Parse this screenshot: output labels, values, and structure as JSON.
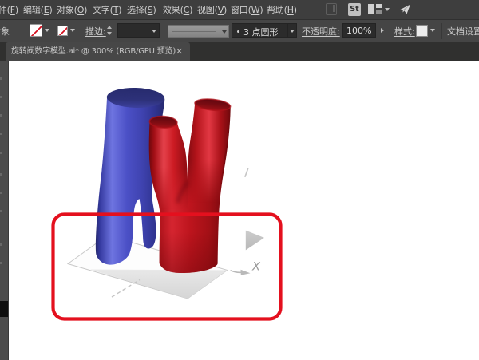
{
  "menubar": {
    "items": [
      {
        "pre": "文件(",
        "key": "F",
        "post": ")"
      },
      {
        "pre": "编辑(",
        "key": "E",
        "post": ")"
      },
      {
        "pre": "对象(",
        "key": "O",
        "post": ")"
      },
      {
        "pre": "文字(",
        "key": "T",
        "post": ")"
      },
      {
        "pre": "选择(",
        "key": "S",
        "post": ")"
      },
      {
        "pre": "效果(",
        "key": "C",
        "post": ")"
      },
      {
        "pre": "视图(",
        "key": "V",
        "post": ")"
      },
      {
        "pre": "窗口(",
        "key": "W",
        "post": ")"
      },
      {
        "pre": "帮助(",
        "key": "H",
        "post": ")"
      }
    ],
    "stock_icon_text": "St"
  },
  "controlbar": {
    "selection_label": "对象",
    "stroke_label": "描边:",
    "brush_value": "3 点圆形",
    "opacity_label": "不透明度:",
    "opacity_value": "100%",
    "style_label": "样式:",
    "document_setup_label": "文档设置"
  },
  "tabbar": {
    "title": "旋转阀数字模型.ai* @ 300% (RGB/GPU 预览)",
    "close": "✕"
  },
  "artboard": {
    "axis_x_label": "X"
  },
  "icons": {
    "home-icon": "css-outline-square",
    "stock-icon": "St",
    "workspace-icon": "css-squares",
    "chevron-down-icon": "▾",
    "share-icon": "paper-plane",
    "submenu-arrow-icon": "▸",
    "spinner-icon": "▴▾",
    "none-swatch-icon": "white square with red slash",
    "close-icon": "✕"
  },
  "colors": {
    "annotation-red": "#e4101e",
    "blue-dark": "#212463",
    "blue-main": "#4b50c6",
    "blue-highlight": "#6e74e0",
    "blue-top": "#2a2d74",
    "red-dark": "#66060a",
    "red-main": "#c2161e",
    "red-highlight": "#e23843",
    "red-top": "#6b080d",
    "floor-gray": "#e2e2e2",
    "ui-bar": "#3e3e3e",
    "ui-control": "#454545",
    "ui-tab": "#474747"
  }
}
